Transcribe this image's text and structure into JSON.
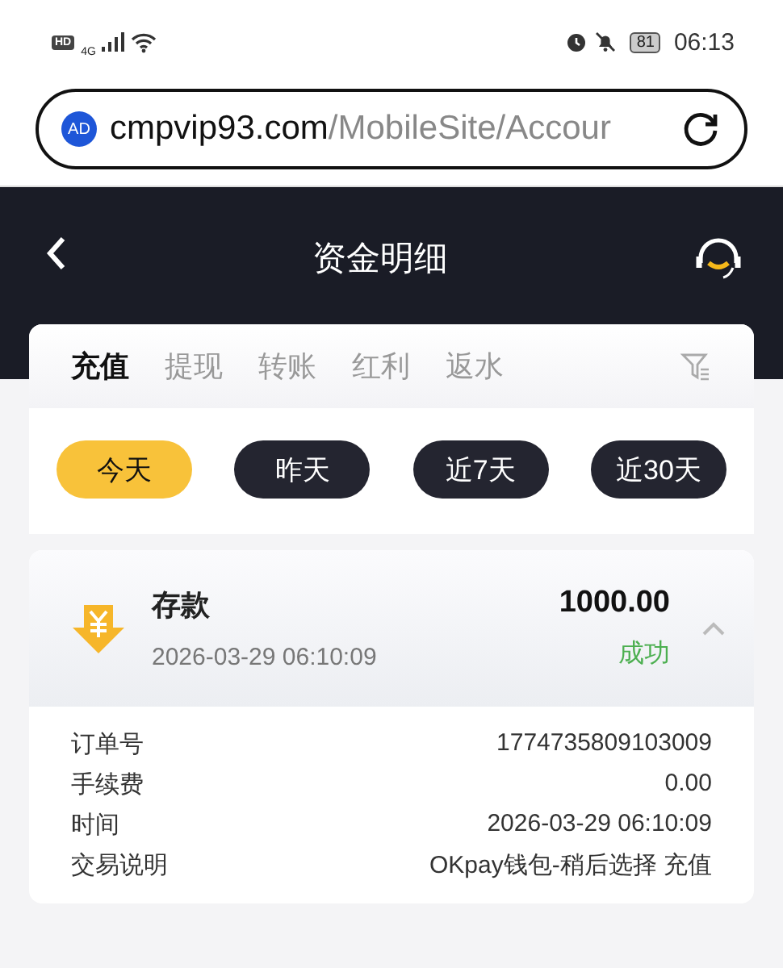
{
  "status_bar": {
    "hd": "HD",
    "network": "4G",
    "battery": "81",
    "time": "06:13"
  },
  "address_bar": {
    "badge": "AD",
    "host": "cmpvip93.com",
    "path": "/MobileSite/Accour"
  },
  "header": {
    "title": "资金明细"
  },
  "tabs": [
    {
      "label": "充值",
      "selected": true
    },
    {
      "label": "提现",
      "selected": false
    },
    {
      "label": "转账",
      "selected": false
    },
    {
      "label": "红利",
      "selected": false
    },
    {
      "label": "返水",
      "selected": false
    }
  ],
  "date_filters": [
    {
      "label": "今天",
      "selected": true
    },
    {
      "label": "昨天",
      "selected": false
    },
    {
      "label": "近7天",
      "selected": false
    },
    {
      "label": "近30天",
      "selected": false
    }
  ],
  "records": [
    {
      "title": "存款",
      "time": "2026-03-29 06:10:09",
      "amount": "1000.00",
      "status": "成功",
      "color": "#4caf50",
      "expanded": true,
      "details": [
        {
          "label": "订单号",
          "value": "1774735809103009"
        },
        {
          "label": "手续费",
          "value": "0.00"
        },
        {
          "label": "时间",
          "value": "2026-03-29 06:10:09"
        },
        {
          "label": "交易说明",
          "value": "OKpay钱包-稍后选择 充值"
        }
      ]
    }
  ]
}
